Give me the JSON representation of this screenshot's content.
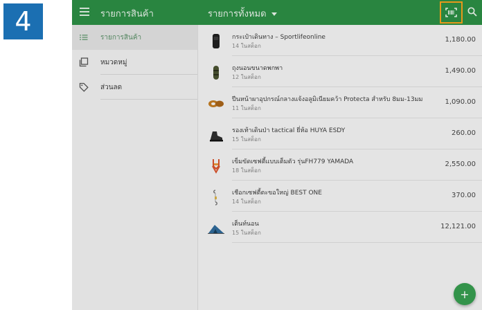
{
  "step": {
    "number": "4"
  },
  "topbar": {
    "title": "รายการสินค้า",
    "filter_label": "รายการทั้งหมด",
    "icons": {
      "menu": "menu-icon",
      "scan": "barcode-scan-icon",
      "search": "search-icon"
    }
  },
  "sidebar": {
    "items": [
      {
        "label": "รายการสินค้า",
        "icon": "list-icon",
        "active": true
      },
      {
        "label": "หมวดหมู่",
        "icon": "categories-icon",
        "active": false
      },
      {
        "label": "ส่วนลด",
        "icon": "tag-icon",
        "active": false
      }
    ]
  },
  "products": [
    {
      "name": "กระเป๋าเดินทาง – Sportlifeonline",
      "stock": "14 ในสต็อก",
      "price": "1,180.00",
      "icon": "backpack-icon"
    },
    {
      "name": "ถุงนอนขนาดพกพา",
      "stock": "12 ในสต็อก",
      "price": "1,490.00",
      "icon": "sleeping-bag-icon"
    },
    {
      "name": "ปีนหน้าผาอุปกรณ์กลางแจ้งอลูมิเนียมคว้า Protecta สำหรับ 8มม-13มม",
      "stock": "11 ในสต็อก",
      "price": "1,090.00",
      "icon": "climbing-gear-icon"
    },
    {
      "name": "รองเท้าเดินป่า tactical ยี่ห้อ HUYA ESDY",
      "stock": "15 ในสต็อก",
      "price": "260.00",
      "icon": "boot-icon"
    },
    {
      "name": "เข็มขัดเซฟตี้แบบเต็มตัว รุ่นFH779 YAMADA",
      "stock": "18 ในสต็อก",
      "price": "2,550.00",
      "icon": "harness-icon"
    },
    {
      "name": "เชือกเซฟตี้ตะขอใหญ่ BEST ONE",
      "stock": "14 ในสต็อก",
      "price": "370.00",
      "icon": "rope-hook-icon"
    },
    {
      "name": "เต็นท์นอน",
      "stock": "15 ในสต็อก",
      "price": "12,121.00",
      "icon": "tent-icon"
    }
  ],
  "fab": {
    "label": "+"
  },
  "colors": {
    "primary": "#2c8e45",
    "accent_highlight": "#f7a21c",
    "step_badge": "#1b6fb2",
    "fab": "#379d4f"
  }
}
